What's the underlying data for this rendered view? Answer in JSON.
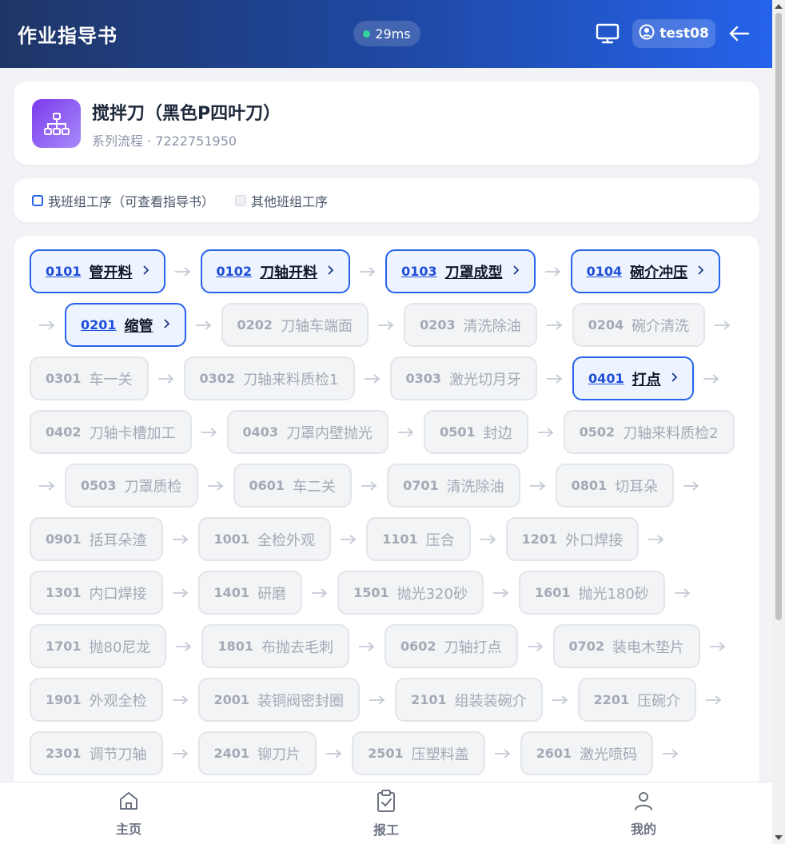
{
  "header": {
    "title": "作业指导书",
    "latency": "29ms",
    "username": "test08"
  },
  "product": {
    "name": "搅拌刀（黑色P四叶刀）",
    "subtitle": "系列流程 · 7222751950"
  },
  "legend": {
    "mine": "我班组工序（可查看指导书）",
    "other": "其他班组工序"
  },
  "steps": [
    {
      "code": "0101",
      "name": "管开料",
      "mine": true
    },
    {
      "code": "0102",
      "name": "刀轴开料",
      "mine": true
    },
    {
      "code": "0103",
      "name": "刀罩成型",
      "mine": true
    },
    {
      "code": "0104",
      "name": "碗介冲压",
      "mine": true
    },
    {
      "code": "0201",
      "name": "缩管",
      "mine": true
    },
    {
      "code": "0202",
      "name": "刀轴车端面",
      "mine": false
    },
    {
      "code": "0203",
      "name": "清洗除油",
      "mine": false
    },
    {
      "code": "0204",
      "name": "碗介清洗",
      "mine": false
    },
    {
      "code": "0301",
      "name": "车一关",
      "mine": false
    },
    {
      "code": "0302",
      "name": "刀轴来料质检1",
      "mine": false
    },
    {
      "code": "0303",
      "name": "激光切月牙",
      "mine": false
    },
    {
      "code": "0401",
      "name": "打点",
      "mine": true
    },
    {
      "code": "0402",
      "name": "刀轴卡槽加工",
      "mine": false
    },
    {
      "code": "0403",
      "name": "刀罩内壁抛光",
      "mine": false
    },
    {
      "code": "0501",
      "name": "封边",
      "mine": false
    },
    {
      "code": "0502",
      "name": "刀轴来料质检2",
      "mine": false
    },
    {
      "code": "0503",
      "name": "刀罩质检",
      "mine": false
    },
    {
      "code": "0601",
      "name": "车二关",
      "mine": false
    },
    {
      "code": "0701",
      "name": "清洗除油",
      "mine": false
    },
    {
      "code": "0801",
      "name": "切耳朵",
      "mine": false
    },
    {
      "code": "0901",
      "name": "括耳朵渣",
      "mine": false
    },
    {
      "code": "1001",
      "name": "全检外观",
      "mine": false
    },
    {
      "code": "1101",
      "name": "压合",
      "mine": false
    },
    {
      "code": "1201",
      "name": "外口焊接",
      "mine": false
    },
    {
      "code": "1301",
      "name": "内口焊接",
      "mine": false
    },
    {
      "code": "1401",
      "name": "研磨",
      "mine": false
    },
    {
      "code": "1501",
      "name": "抛光320砂",
      "mine": false
    },
    {
      "code": "1601",
      "name": "抛光180砂",
      "mine": false
    },
    {
      "code": "1701",
      "name": "抛80尼龙",
      "mine": false
    },
    {
      "code": "1801",
      "name": "布抛去毛刺",
      "mine": false
    },
    {
      "code": "0602",
      "name": "刀轴打点",
      "mine": false
    },
    {
      "code": "0702",
      "name": "装电木垫片",
      "mine": false
    },
    {
      "code": "1901",
      "name": "外观全检",
      "mine": false
    },
    {
      "code": "2001",
      "name": "装铜阀密封圈",
      "mine": false
    },
    {
      "code": "2101",
      "name": "组装装碗介",
      "mine": false
    },
    {
      "code": "2201",
      "name": "压碗介",
      "mine": false
    },
    {
      "code": "2301",
      "name": "调节刀轴",
      "mine": false
    },
    {
      "code": "2401",
      "name": "铆刀片",
      "mine": false
    },
    {
      "code": "2501",
      "name": "压塑料盖",
      "mine": false
    },
    {
      "code": "2601",
      "name": "激光喷码",
      "mine": false
    }
  ],
  "nav": {
    "home": "主页",
    "report": "报工",
    "mine": "我的"
  },
  "colors": {
    "accent": "#2563eb",
    "header_start": "#1f3566",
    "header_end": "#2563eb",
    "icon_bg": "#7c3aed"
  },
  "icons": {
    "monitor": "monitor-icon",
    "user": "user-circle-icon",
    "back": "arrow-left-icon",
    "process": "sitemap-icon"
  }
}
